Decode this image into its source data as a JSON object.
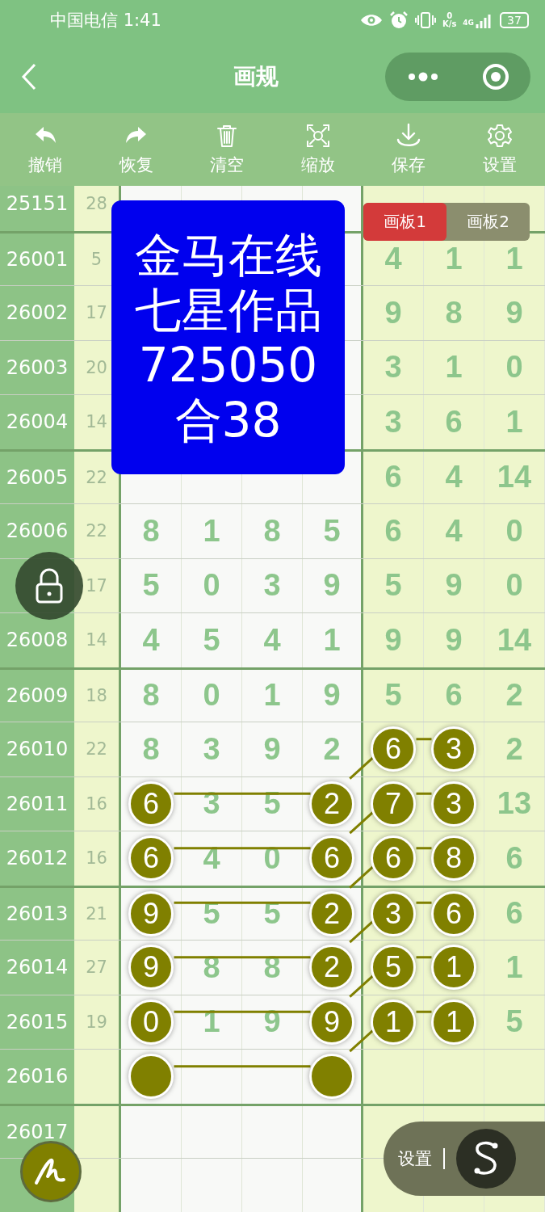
{
  "status_bar": {
    "carrier_time": "中国电信 1:41",
    "speed_value": "0",
    "speed_unit": "K/s",
    "network_type": "4G",
    "battery": "37"
  },
  "title_bar": {
    "title": "画规"
  },
  "toolbar": [
    {
      "label": "撤销",
      "kind": "undo"
    },
    {
      "label": "恢复",
      "kind": "redo"
    },
    {
      "label": "清空",
      "kind": "clear"
    },
    {
      "label": "缩放",
      "kind": "zoom"
    },
    {
      "label": "保存",
      "kind": "save"
    },
    {
      "label": "设置",
      "kind": "settings"
    }
  ],
  "board_tabs": [
    {
      "label": "画板1",
      "selected": true
    },
    {
      "label": "画板2",
      "selected": false
    }
  ],
  "notice": {
    "lines": [
      "金马在线",
      "七星作品",
      "725050",
      "合38"
    ]
  },
  "grid": {
    "rows": [
      {
        "issue": "25151",
        "sum": "28"
      },
      {
        "issue": "26001",
        "sum": "5",
        "cells": [
          null,
          null,
          null,
          {},
          {
            "value": "4",
            "circled": false
          },
          {
            "value": "1",
            "circled": false
          },
          {
            "value": "1",
            "circled": false
          }
        ]
      },
      {
        "issue": "26002",
        "sum": "17",
        "cells": [
          null,
          null,
          null,
          {},
          {
            "value": "9",
            "circled": false
          },
          {
            "value": "8",
            "circled": false
          },
          {
            "value": "9",
            "circled": false
          }
        ]
      },
      {
        "issue": "26003",
        "sum": "20",
        "cells": [
          null,
          null,
          null,
          {},
          {
            "value": "3",
            "circled": false
          },
          {
            "value": "1",
            "circled": false
          },
          {
            "value": "0",
            "circled": false
          }
        ]
      },
      {
        "issue": "26004",
        "sum": "14",
        "cells": [
          null,
          null,
          null,
          {},
          {
            "value": "3",
            "circled": false
          },
          {
            "value": "6",
            "circled": false
          },
          {
            "value": "1",
            "circled": false
          }
        ]
      },
      {
        "issue": "26005",
        "sum": "22",
        "cells": [
          {},
          {},
          {},
          {},
          {
            "value": "6",
            "circled": false
          },
          {
            "value": "4",
            "circled": false
          },
          {
            "value": "14",
            "circled": false
          }
        ]
      },
      {
        "issue": "26006",
        "sum": "22",
        "cells": [
          {
            "value": "8",
            "circled": false
          },
          {
            "value": "1",
            "circled": false
          },
          {
            "value": "8",
            "circled": false
          },
          {
            "value": "5",
            "circled": false
          },
          {
            "value": "6",
            "circled": false
          },
          {
            "value": "4",
            "circled": false
          },
          {
            "value": "0",
            "circled": false
          }
        ]
      },
      {
        "sum": "17",
        "cells": [
          {
            "value": "5",
            "circled": false
          },
          {
            "value": "0",
            "circled": false
          },
          {
            "value": "3",
            "circled": false
          },
          {
            "value": "9",
            "circled": false
          },
          {
            "value": "5",
            "circled": false
          },
          {
            "value": "9",
            "circled": false
          },
          {
            "value": "0",
            "circled": false
          }
        ]
      },
      {
        "issue": "26008",
        "sum": "14",
        "cells": [
          {
            "value": "4",
            "circled": false
          },
          {
            "value": "5",
            "circled": false
          },
          {
            "value": "4",
            "circled": false
          },
          {
            "value": "1",
            "circled": false
          },
          {
            "value": "9",
            "circled": false
          },
          {
            "value": "9",
            "circled": false
          },
          {
            "value": "14",
            "circled": false
          }
        ]
      },
      {
        "issue": "26009",
        "sum": "18",
        "cells": [
          {
            "value": "8",
            "circled": false
          },
          {
            "value": "0",
            "circled": false
          },
          {
            "value": "1",
            "circled": false
          },
          {
            "value": "9",
            "circled": false
          },
          {
            "value": "5",
            "circled": false
          },
          {
            "value": "6",
            "circled": false
          },
          {
            "value": "2",
            "circled": false
          }
        ]
      },
      {
        "issue": "26010",
        "sum": "22",
        "cells": [
          {
            "value": "8",
            "circled": false
          },
          {
            "value": "3",
            "circled": false
          },
          {
            "value": "9",
            "circled": false
          },
          {
            "value": "2",
            "circled": false
          },
          {
            "value": "6",
            "circled": true
          },
          {
            "value": "3",
            "circled": true
          },
          {
            "value": "2",
            "circled": false
          }
        ]
      },
      {
        "issue": "26011",
        "sum": "16",
        "cells": [
          {
            "value": "6",
            "circled": true
          },
          {
            "value": "3",
            "circled": false
          },
          {
            "value": "5",
            "circled": false
          },
          {
            "value": "2",
            "circled": true
          },
          {
            "value": "7",
            "circled": true
          },
          {
            "value": "3",
            "circled": true
          },
          {
            "value": "13",
            "circled": false
          }
        ]
      },
      {
        "issue": "26012",
        "sum": "16",
        "cells": [
          {
            "value": "6",
            "circled": true
          },
          {
            "value": "4",
            "circled": false
          },
          {
            "value": "0",
            "circled": false
          },
          {
            "value": "6",
            "circled": true
          },
          {
            "value": "6",
            "circled": true
          },
          {
            "value": "8",
            "circled": true
          },
          {
            "value": "6",
            "circled": false
          }
        ]
      },
      {
        "issue": "26013",
        "sum": "21",
        "cells": [
          {
            "value": "9",
            "circled": true
          },
          {
            "value": "5",
            "circled": false
          },
          {
            "value": "5",
            "circled": false
          },
          {
            "value": "2",
            "circled": true
          },
          {
            "value": "3",
            "circled": true
          },
          {
            "value": "6",
            "circled": true
          },
          {
            "value": "6",
            "circled": false
          }
        ]
      },
      {
        "issue": "26014",
        "sum": "27",
        "cells": [
          {
            "value": "9",
            "circled": true
          },
          {
            "value": "8",
            "circled": false
          },
          {
            "value": "8",
            "circled": false
          },
          {
            "value": "2",
            "circled": true
          },
          {
            "value": "5",
            "circled": true
          },
          {
            "value": "1",
            "circled": true
          },
          {
            "value": "1",
            "circled": false
          }
        ]
      },
      {
        "issue": "26015",
        "sum": "19",
        "cells": [
          {
            "value": "0",
            "circled": true
          },
          {
            "value": "1",
            "circled": false
          },
          {
            "value": "9",
            "circled": false
          },
          {
            "value": "9",
            "circled": true
          },
          {
            "value": "1",
            "circled": true
          },
          {
            "value": "1",
            "circled": true
          },
          {
            "value": "5",
            "circled": false
          }
        ]
      },
      {
        "issue": "26016",
        "cells": [
          {
            "circled": true
          },
          {},
          {},
          {
            "circled": true
          },
          {},
          {},
          {}
        ]
      },
      {
        "issue": "26017"
      },
      {}
    ]
  },
  "floating_panel": {
    "label": "设置"
  }
}
